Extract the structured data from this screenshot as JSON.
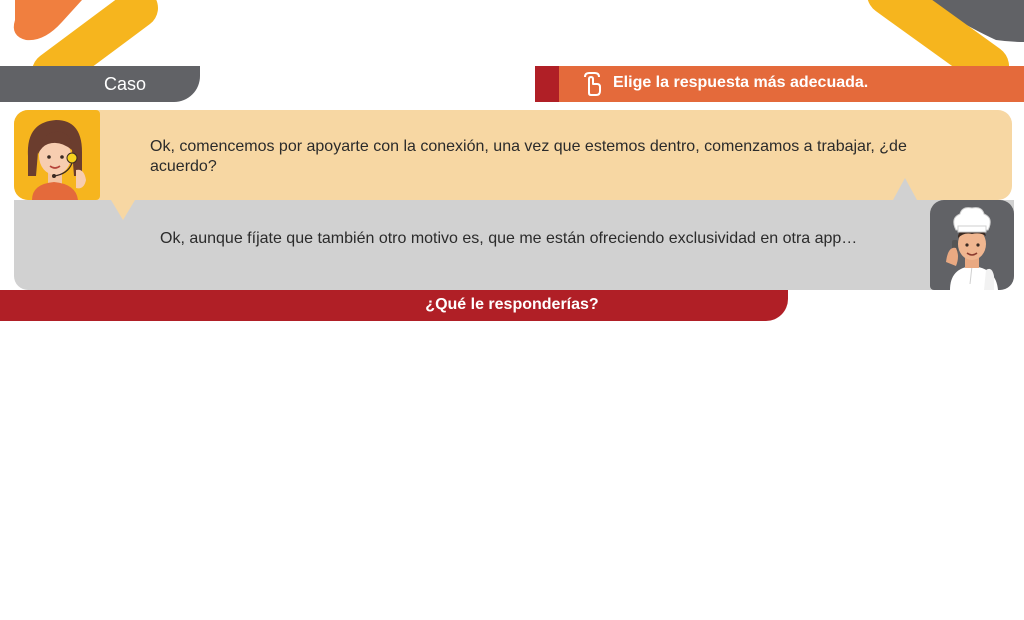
{
  "header": {
    "caso_label": "Caso",
    "instruction": "Elige la respuesta más adecuada.",
    "instruction_icon": "tap-finger-icon"
  },
  "dialogue": {
    "agent": {
      "avatar": "agent-headset-avatar",
      "message": "Ok, comencemos por apoyarte con la conexión, una vez que estemos dentro, comenzamos a trabajar, ¿de acuerdo?"
    },
    "customer": {
      "avatar": "chef-phone-avatar",
      "message": "Ok, aunque fíjate que también otro motivo es, que me están ofreciendo exclusividad en otra app…"
    }
  },
  "question": "¿Qué le responderías?",
  "colors": {
    "dark_gray": "#616266",
    "orange": "#e46a3b",
    "dark_red": "#b01f26",
    "yellow": "#f6b51e",
    "peach_bubble": "#f7d7a3",
    "gray_bubble": "#d1d1d1"
  }
}
